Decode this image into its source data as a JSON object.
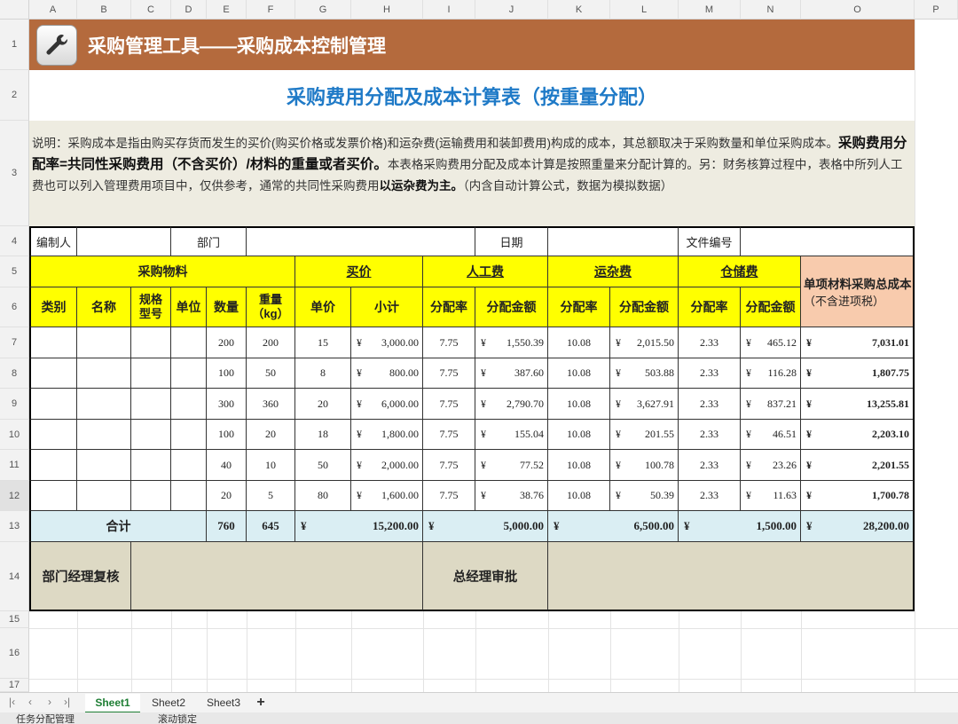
{
  "columns": [
    "A",
    "B",
    "C",
    "D",
    "E",
    "F",
    "G",
    "H",
    "I",
    "J",
    "K",
    "L",
    "M",
    "N",
    "O",
    "P"
  ],
  "rows": [
    "1",
    "2",
    "3",
    "4",
    "5",
    "6",
    "7",
    "8",
    "9",
    "10",
    "11",
    "12",
    "13",
    "14",
    "15",
    "16",
    "17"
  ],
  "banner": {
    "title": "采购管理工具——采购成本控制管理",
    "color": "#b46a3d"
  },
  "heading": "采购费用分配及成本计算表（按重量分配）",
  "note": {
    "p1": "说明：采购成本是指由购买存货而发生的买价(购买价格或发票价格)和运杂费(运输费用和装卸费用)构成的成本，其总额取决于采购数量和单位采购成本。",
    "p2": "采购费用分配率=共同性采购费用（不含买价）/材料的重量或者买价。",
    "p3": "本表格采购费用分配及成本计算是按照重量来分配计算的。另：财务核算过程中，表格中所列人工费也可以列入管理费用项目中，仅供参考，通常的共同性采购费用",
    "p4": "以运杂费为主。",
    "p5": "（内含自动计算公式，数据为模拟数据）"
  },
  "info": {
    "preparer": "编制人",
    "dept": "部门",
    "date": "日期",
    "doc_no": "文件编号"
  },
  "groups": {
    "material": "采购物料",
    "price": "买价",
    "labor": "人工费",
    "freight": "运杂费",
    "storage": "仓储费",
    "total": "单项材料采购总成本",
    "total_note": "（不含进项税）"
  },
  "sub": {
    "category": "类别",
    "name": "名称",
    "spec": "规格型号",
    "unit": "单位",
    "qty": "数量",
    "weight": "重量（kg）",
    "unit_price": "单价",
    "subtotal": "小计",
    "rate": "分配率",
    "amount": "分配金额"
  },
  "currency": "¥",
  "table_rows": [
    {
      "qty": "200",
      "weight": "200",
      "price": "15",
      "subtotal": "3,000.00",
      "labor_rate": "7.75",
      "labor_amt": "1,550.39",
      "freight_rate": "10.08",
      "freight_amt": "2,015.50",
      "storage_rate": "2.33",
      "storage_amt": "465.12",
      "total": "7,031.01"
    },
    {
      "qty": "100",
      "weight": "50",
      "price": "8",
      "subtotal": "800.00",
      "labor_rate": "7.75",
      "labor_amt": "387.60",
      "freight_rate": "10.08",
      "freight_amt": "503.88",
      "storage_rate": "2.33",
      "storage_amt": "116.28",
      "total": "1,807.75"
    },
    {
      "qty": "300",
      "weight": "360",
      "price": "20",
      "subtotal": "6,000.00",
      "labor_rate": "7.75",
      "labor_amt": "2,790.70",
      "freight_rate": "10.08",
      "freight_amt": "3,627.91",
      "storage_rate": "2.33",
      "storage_amt": "837.21",
      "total": "13,255.81"
    },
    {
      "qty": "100",
      "weight": "20",
      "price": "18",
      "subtotal": "1,800.00",
      "labor_rate": "7.75",
      "labor_amt": "155.04",
      "freight_rate": "10.08",
      "freight_amt": "201.55",
      "storage_rate": "2.33",
      "storage_amt": "46.51",
      "total": "2,203.10"
    },
    {
      "qty": "40",
      "weight": "10",
      "price": "50",
      "subtotal": "2,000.00",
      "labor_rate": "7.75",
      "labor_amt": "77.52",
      "freight_rate": "10.08",
      "freight_amt": "100.78",
      "storage_rate": "2.33",
      "storage_amt": "23.26",
      "total": "2,201.55"
    },
    {
      "qty": "20",
      "weight": "5",
      "price": "80",
      "subtotal": "1,600.00",
      "labor_rate": "7.75",
      "labor_amt": "38.76",
      "freight_rate": "10.08",
      "freight_amt": "50.39",
      "storage_rate": "2.33",
      "storage_amt": "11.63",
      "total": "1,700.78"
    }
  ],
  "totals": {
    "label": "合计",
    "qty": "760",
    "weight": "645",
    "price": "15,200.00",
    "labor": "5,000.00",
    "freight": "6,500.00",
    "storage": "1,500.00",
    "total": "28,200.00"
  },
  "approval": {
    "dept_review": "部门经理复核",
    "gm_approve": "总经理审批"
  },
  "sheets": [
    "Sheet1",
    "Sheet2",
    "Sheet3"
  ],
  "add_sheet": "+",
  "status": {
    "left": "任务分配管理",
    "mid": "滚动锁定"
  }
}
